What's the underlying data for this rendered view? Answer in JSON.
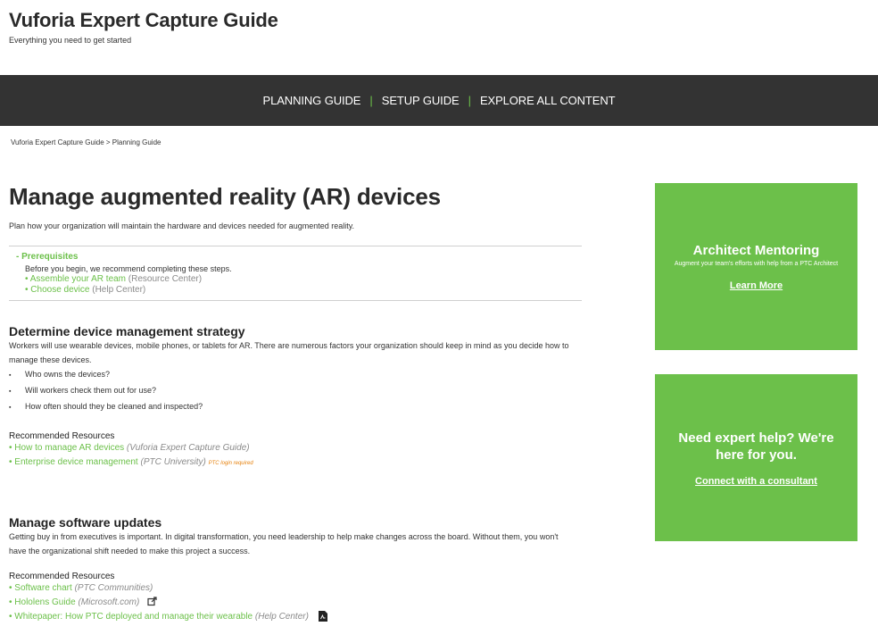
{
  "header": {
    "title": "Vuforia Expert Capture Guide",
    "tagline": "Everything you need to get started"
  },
  "nav": {
    "items": [
      "PLANNING GUIDE",
      "SETUP GUIDE",
      "EXPLORE ALL CONTENT"
    ],
    "separator": "|"
  },
  "breadcrumb": "Vuforia Expert Capture Guide > Planning Guide",
  "page": {
    "title": "Manage augmented reality (AR) devices",
    "intro": "Plan how your organization will maintain the hardware and devices needed for augmented reality."
  },
  "prereq": {
    "heading": "- Prerequisites",
    "text": "Before you begin, we recommend completing these steps.",
    "items": [
      {
        "bullet": "•",
        "link": "Assemble your AR team",
        "source": "(Resource Center)"
      },
      {
        "bullet": "•",
        "link": "Choose device",
        "source": "(Help Center)"
      }
    ]
  },
  "section1": {
    "title": "Determine device management strategy",
    "body": "Workers will use wearable devices, mobile phones, or tablets for AR. There are numerous factors your organization should keep in mind as you decide how to manage these devices.",
    "bullets": [
      "Who owns the devices?",
      "Will workers check them out for use?",
      "How often should they be cleaned and inspected?"
    ],
    "resources_heading": "Recommended Resources",
    "resources": [
      {
        "bullet": "•",
        "link": "How to manage AR devices",
        "source": "(Vuforia Expert Capture Guide)",
        "note": ""
      },
      {
        "bullet": "•",
        "link": "Enterprise device management",
        "source": "(PTC University)",
        "note": "PTC login required"
      }
    ]
  },
  "section2": {
    "title": "Manage software updates",
    "body": "Getting buy in from executives is important. In digital transformation, you need leadership to help make changes across the board. Without them, you won't have the organizational shift needed to make this project a success.",
    "resources_heading": "Recommended Resources",
    "resources": [
      {
        "bullet": "•",
        "link": "Software chart",
        "source": "(PTC Communities)",
        "icon": ""
      },
      {
        "bullet": "•",
        "link": "Hololens Guide",
        "source": "(Microsoft.com)",
        "icon": "external-link-icon"
      },
      {
        "bullet": "•",
        "link": "Whitepaper: How PTC deployed and manage their wearable",
        "source": "(Help Center)",
        "icon": "pdf-icon"
      }
    ]
  },
  "promo1": {
    "title": "Architect Mentoring",
    "subtitle": "Augment your team's efforts with help from a PTC Architect",
    "link": "Learn More"
  },
  "promo2": {
    "title": "Need expert help? We're here for you.",
    "link": "Connect with a consultant"
  },
  "colors": {
    "accent": "#6cc04a",
    "nav_bg": "#333333",
    "note": "#e6820e"
  }
}
